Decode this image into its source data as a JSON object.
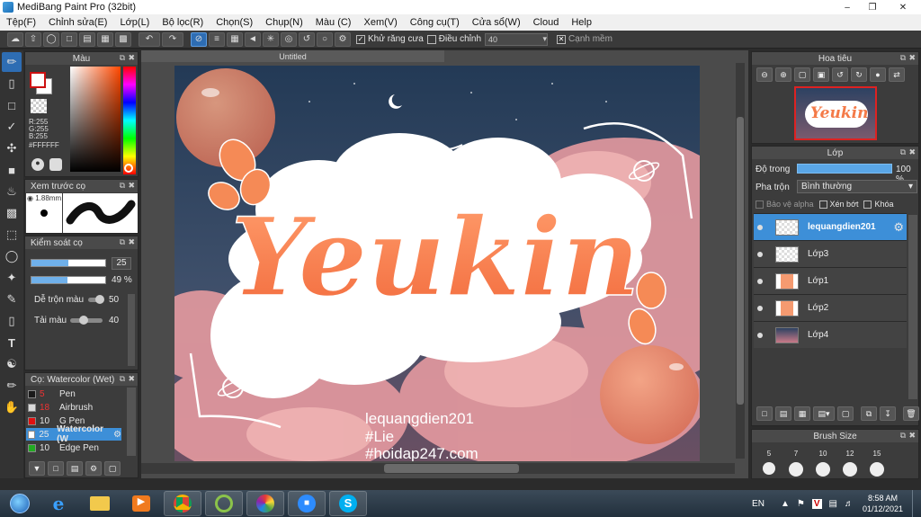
{
  "window": {
    "title": "MediBang Paint Pro (32bit)"
  },
  "menu": [
    "Tệp(F)",
    "Chỉnh sửa(E)",
    "Lớp(L)",
    "Bộ lọc(R)",
    "Chọn(S)",
    "Chụp(N)",
    "Màu (C)",
    "Xem(V)",
    "Công cụ(T)",
    "Cửa sổ(W)",
    "Cloud",
    "Help"
  ],
  "toolbar": {
    "antialias_label": "Khử răng cưa",
    "adjust_label": "Điều chỉnh",
    "adjust_value": "40",
    "edge_label": "Cạnh mềm"
  },
  "color_panel": {
    "title": "Màu",
    "r": "R:255",
    "g": "G:255",
    "b": "B:255",
    "hex": "#FFFFFF",
    "fg": "#ffffff",
    "bg": "#cc1111"
  },
  "brush_preview": {
    "title": "Xem trước cọ",
    "size": "1.88mm"
  },
  "brush_control": {
    "title": "Kiểm soát cọ",
    "size_value": "25",
    "opacity_value": "49 %",
    "mix_label": "Dễ trộn màu",
    "mix_value": "50",
    "load_label": "Tải màu",
    "load_value": "40"
  },
  "brush_list": {
    "title": "Cọ: Watercolor (Wet)",
    "items": [
      {
        "size": "5",
        "name": "Pen",
        "color": "#1a1a1a"
      },
      {
        "size": "18",
        "name": "Airbrush",
        "color": "#d8d8d8"
      },
      {
        "size": "10",
        "name": "G Pen",
        "color": "#e01010"
      },
      {
        "size": "25",
        "name": "Watercolor (W",
        "color": "#ffffff",
        "selected": true
      },
      {
        "size": "10",
        "name": "Edge Pen",
        "color": "#22aa22"
      }
    ]
  },
  "canvas": {
    "tab": "Untitled",
    "art_title": "Yeukin",
    "watermark_line1": "lequangdien201",
    "watermark_line2": "#Lie",
    "watermark_line3": "#hoidap247.com"
  },
  "navigator": {
    "title": "Hoa tiêu",
    "thumb_text": "Yeukin"
  },
  "layers": {
    "title": "Lớp",
    "opacity_label": "Độ trong",
    "opacity_value": "100 %",
    "blend_label": "Pha trộn",
    "blend_value": "Bình thường",
    "protect_alpha": "Bảo vệ alpha",
    "clip": "Xén bớt",
    "lock": "Khóa",
    "items": [
      "lequangdien201",
      "Lớp3",
      "Lớp1",
      "Lớp2",
      "Lớp4"
    ]
  },
  "brush_size_panel": {
    "title": "Brush Size",
    "sizes": [
      "5",
      "7",
      "10",
      "12",
      "15"
    ]
  },
  "taskbar": {
    "lang": "EN",
    "time": "8:58 AM",
    "date": "01/12/2021"
  }
}
